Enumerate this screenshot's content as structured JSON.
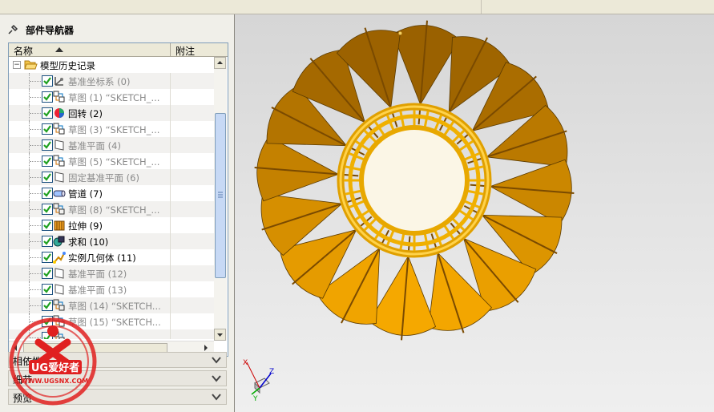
{
  "navigator": {
    "title": "部件导航器",
    "columns": {
      "name": "名称",
      "note": "附注"
    },
    "root_label": "模型历史记录",
    "items": [
      {
        "label": "基准坐标系 (0)",
        "icon": "datum-csys-icon",
        "dim": true
      },
      {
        "label": "草图 (1) “SKETCH_...",
        "icon": "sketch-icon",
        "dim": true
      },
      {
        "label": "回转 (2)",
        "icon": "revolve-icon",
        "dim": false
      },
      {
        "label": "草图 (3) “SKETCH_...",
        "icon": "sketch-icon",
        "dim": true
      },
      {
        "label": "基准平面 (4)",
        "icon": "datum-plane-icon",
        "dim": true
      },
      {
        "label": "草图 (5) “SKETCH_...",
        "icon": "sketch-icon",
        "dim": true
      },
      {
        "label": "固定基准平面 (6)",
        "icon": "datum-plane-icon",
        "dim": true
      },
      {
        "label": "管道 (7)",
        "icon": "tube-icon",
        "dim": false
      },
      {
        "label": "草图 (8) “SKETCH_...",
        "icon": "sketch-icon",
        "dim": true
      },
      {
        "label": "拉伸 (9)",
        "icon": "extrude-icon",
        "dim": false
      },
      {
        "label": "求和 (10)",
        "icon": "unite-icon",
        "dim": false
      },
      {
        "label": "实例几何体 (11)",
        "icon": "instance-geometry-icon",
        "dim": false
      },
      {
        "label": "基准平面 (12)",
        "icon": "datum-plane-icon",
        "dim": true
      },
      {
        "label": "基准平面 (13)",
        "icon": "datum-plane-icon",
        "dim": true
      },
      {
        "label": "草图 (14) “SKETCH...",
        "icon": "sketch-icon",
        "dim": true
      },
      {
        "label": "草图 (15) “SKETCH...",
        "icon": "sketch-icon",
        "dim": true
      },
      {
        "label": "...",
        "icon": "sketch-icon",
        "dim": true
      }
    ]
  },
  "sections": [
    {
      "label": "相依性"
    },
    {
      "label": "细节"
    },
    {
      "label": "预览"
    }
  ],
  "watermark": {
    "brand": "UG爱好者",
    "url": "WWW.UGSNX.COM"
  },
  "triad": {
    "x": "X",
    "y": "Y",
    "z": "Z"
  },
  "colors": {
    "accent_select": "#c7d9f5",
    "model_light": "#f5a800",
    "model_dark": "#8a5400",
    "watermark_red": "#e02020"
  }
}
